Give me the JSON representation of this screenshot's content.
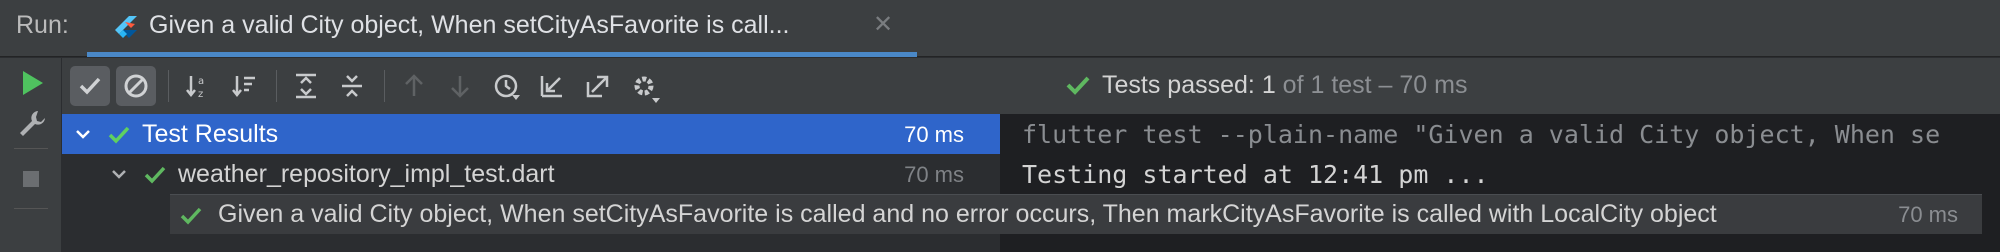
{
  "run_header": {
    "label": "Run:",
    "tab_title": "Given a valid City object, When setCityAsFavorite is call...",
    "tab_close_icon": "close-icon"
  },
  "left_strip": {
    "icons": [
      "run-icon",
      "wrench-icon",
      "stop-icon"
    ]
  },
  "toolbar": {
    "icons": [
      "show-passed-icon",
      "show-ignored-icon",
      "sort-alphabetically-icon",
      "sort-by-duration-icon",
      "expand-all-icon",
      "collapse-all-icon",
      "previous-failed-icon",
      "next-failed-icon",
      "test-history-icon",
      "import-tests-icon",
      "export-tests-icon",
      "settings-icon"
    ],
    "status": {
      "main": "Tests passed:",
      "count": "1",
      "detail": "of 1 test – 70 ms"
    }
  },
  "colors": {
    "accent": "#2f65ca",
    "pass_green": "#5fb860",
    "tab_underline": "#4a88c7",
    "background": "#2b2d30",
    "console_background": "#1e1f22"
  },
  "tree": {
    "rows": [
      {
        "label": "Test Results",
        "time": "70 ms",
        "selected": true
      },
      {
        "label": "weather_repository_impl_test.dart",
        "time": "70 ms",
        "selected": false
      },
      {
        "label": "Given a valid City object, When setCityAsFavorite is called and no error occurs, Then markCityAsFavorite is called with LocalCity object",
        "time": "70 ms",
        "selected": false
      }
    ]
  },
  "console": {
    "lines": [
      "flutter test --plain-name \"Given a valid City object, When se",
      "Testing started at 12:41 pm ..."
    ]
  }
}
